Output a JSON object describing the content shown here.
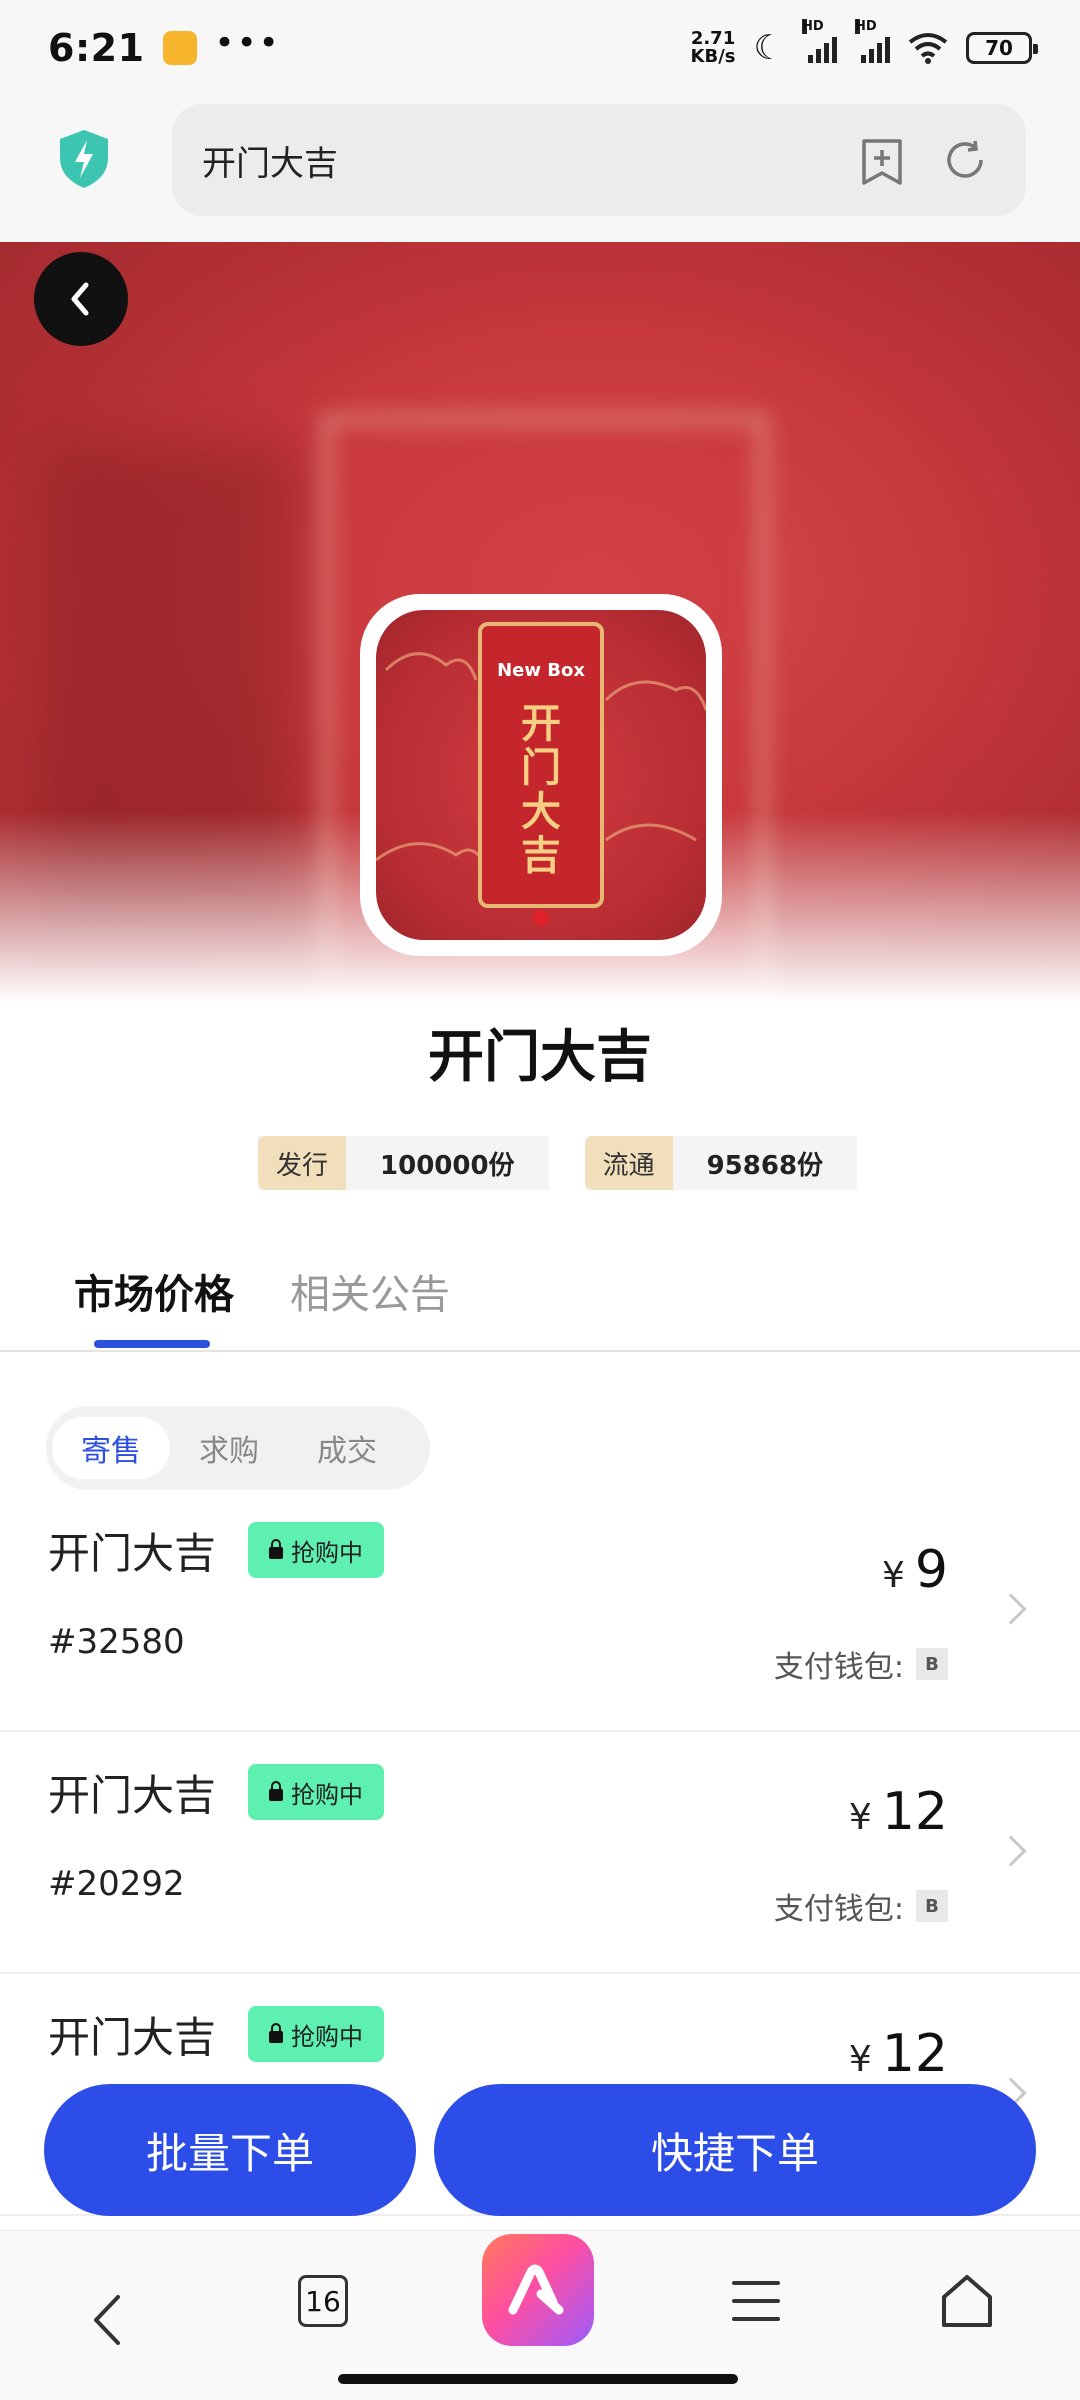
{
  "status_bar": {
    "time": "6:21",
    "dots": "•••",
    "net_speed_value": "2.71",
    "net_speed_unit": "KB/s",
    "signal_1_label": "HD",
    "signal_2_label": "HD",
    "battery": "70"
  },
  "address_bar": {
    "url_text": "开门大吉"
  },
  "product": {
    "thumb_brand": "New Box",
    "thumb_chars": "开门大吉",
    "title": "开门大吉",
    "issue_label": "发行",
    "issue_value": "100000份",
    "circulation_label": "流通",
    "circulation_value": "95868份"
  },
  "tabs": {
    "market_price": "市场价格",
    "announcements": "相关公告"
  },
  "segment": {
    "sell": "寄售",
    "buy": "求购",
    "deal": "成交"
  },
  "listings": [
    {
      "name": "开门大吉",
      "badge": "抢购中",
      "id": "#32580",
      "currency": "¥",
      "price": "9",
      "wallet_label": "支付钱包:",
      "wallet_code": "B"
    },
    {
      "name": "开门大吉",
      "badge": "抢购中",
      "id": "#20292",
      "currency": "¥",
      "price": "12",
      "wallet_label": "支付钱包:",
      "wallet_code": "B"
    },
    {
      "name": "开门大吉",
      "badge": "抢购中",
      "id": "",
      "currency": "¥",
      "price": "12",
      "wallet_label": "",
      "wallet_code": ""
    }
  ],
  "actions": {
    "batch_order": "批量下单",
    "quick_order": "快捷下单"
  },
  "browser_nav": {
    "tab_count": "16"
  },
  "colors": {
    "accent_blue": "#2c4de8",
    "badge_green": "#5ef0b0",
    "stat_label_bg": "#f0dfba",
    "hero_red": "#c8393d"
  }
}
